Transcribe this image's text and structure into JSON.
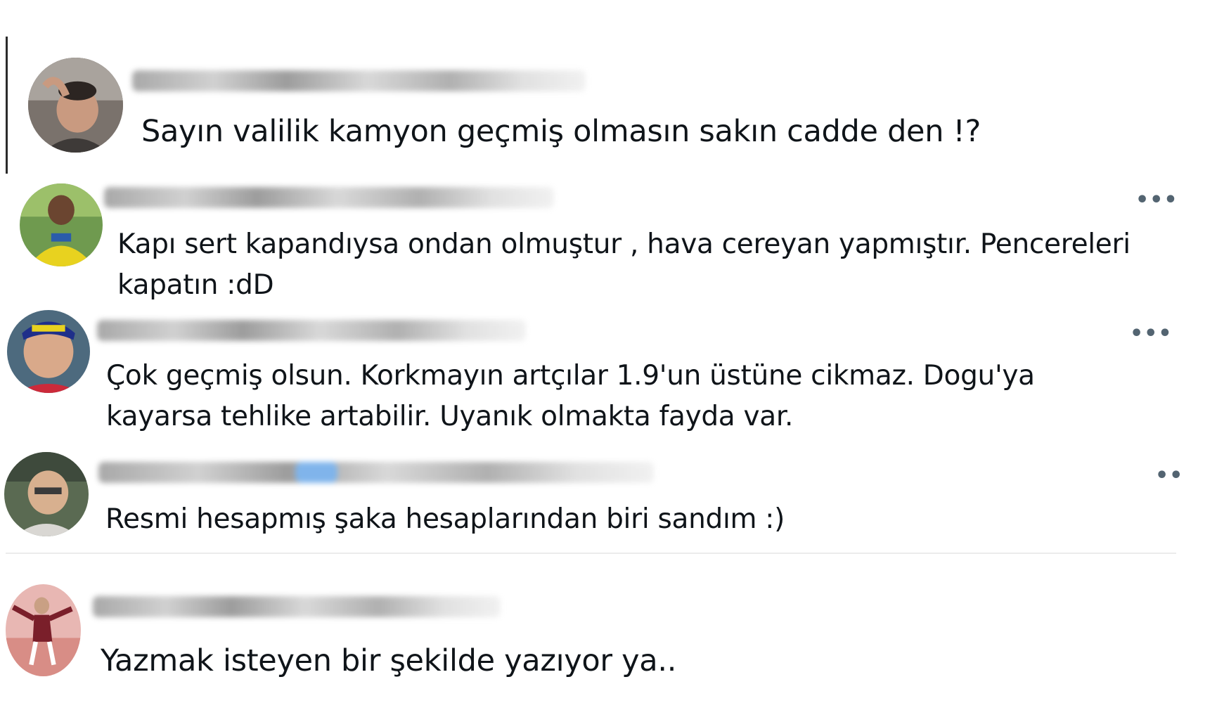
{
  "replies": [
    {
      "text": "Sayın valilik kamyon geçmiş olmasın sakın cadde den !?",
      "more_icon": ""
    },
    {
      "text": "Kapı sert kapandıysa ondan olmuştur , hava cereyan yapmıştır. Pencereleri",
      "text2": "kapatın :dD",
      "more_icon": "•••"
    },
    {
      "text": "Çok geçmiş olsun. Korkmayın artçılar 1.9'un üstüne cikmaz. Dogu'ya",
      "text2": "kayarsa tehlike artabilir. Uyanık olmakta fayda var.",
      "more_icon": "•••"
    },
    {
      "text": "Resmi hesapmış şaka hesaplarından biri  sandım :)",
      "more_icon": "••"
    },
    {
      "text": "Yazmak isteyen bir şekilde yazıyor ya..",
      "more_icon": ""
    }
  ]
}
